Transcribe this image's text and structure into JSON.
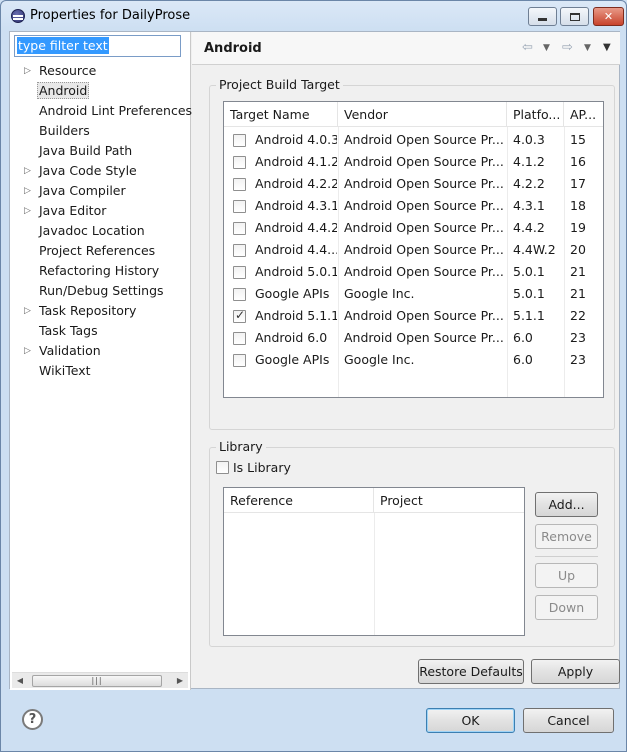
{
  "window": {
    "title": "Properties for DailyProse"
  },
  "filter": {
    "placeholder": "type filter text"
  },
  "tree": [
    {
      "label": "Resource",
      "expandable": true
    },
    {
      "label": "Android",
      "expandable": false,
      "selected": true
    },
    {
      "label": "Android Lint Preferences",
      "expandable": false
    },
    {
      "label": "Builders",
      "expandable": false
    },
    {
      "label": "Java Build Path",
      "expandable": false
    },
    {
      "label": "Java Code Style",
      "expandable": true
    },
    {
      "label": "Java Compiler",
      "expandable": true
    },
    {
      "label": "Java Editor",
      "expandable": true
    },
    {
      "label": "Javadoc Location",
      "expandable": false
    },
    {
      "label": "Project References",
      "expandable": false
    },
    {
      "label": "Refactoring History",
      "expandable": false
    },
    {
      "label": "Run/Debug Settings",
      "expandable": false
    },
    {
      "label": "Task Repository",
      "expandable": true
    },
    {
      "label": "Task Tags",
      "expandable": false
    },
    {
      "label": "Validation",
      "expandable": true
    },
    {
      "label": "WikiText",
      "expandable": false
    }
  ],
  "page": {
    "title": "Android"
  },
  "build_target": {
    "group_label": "Project Build Target",
    "columns": [
      "Target Name",
      "Vendor",
      "Platfo...",
      "AP..."
    ],
    "rows": [
      {
        "name": "Android 4.0.3",
        "vendor": "Android Open Source Pr...",
        "platform": "4.0.3",
        "api": "15",
        "checked": false
      },
      {
        "name": "Android 4.1.2",
        "vendor": "Android Open Source Pr...",
        "platform": "4.1.2",
        "api": "16",
        "checked": false
      },
      {
        "name": "Android 4.2.2",
        "vendor": "Android Open Source Pr...",
        "platform": "4.2.2",
        "api": "17",
        "checked": false
      },
      {
        "name": "Android 4.3.1",
        "vendor": "Android Open Source Pr...",
        "platform": "4.3.1",
        "api": "18",
        "checked": false
      },
      {
        "name": "Android 4.4.2",
        "vendor": "Android Open Source Pr...",
        "platform": "4.4.2",
        "api": "19",
        "checked": false
      },
      {
        "name": "Android 4.4...",
        "vendor": "Android Open Source Pr...",
        "platform": "4.4W.2",
        "api": "20",
        "checked": false
      },
      {
        "name": "Android 5.0.1",
        "vendor": "Android Open Source Pr...",
        "platform": "5.0.1",
        "api": "21",
        "checked": false
      },
      {
        "name": "Google APIs",
        "vendor": "Google Inc.",
        "platform": "5.0.1",
        "api": "21",
        "checked": false
      },
      {
        "name": "Android 5.1.1",
        "vendor": "Android Open Source Pr...",
        "platform": "5.1.1",
        "api": "22",
        "checked": true
      },
      {
        "name": "Android 6.0",
        "vendor": "Android Open Source Pr...",
        "platform": "6.0",
        "api": "23",
        "checked": false
      },
      {
        "name": "Google APIs",
        "vendor": "Google Inc.",
        "platform": "6.0",
        "api": "23",
        "checked": false
      }
    ]
  },
  "library": {
    "group_label": "Library",
    "is_library_label": "Is Library",
    "is_library_checked": false,
    "columns": [
      "Reference",
      "Project"
    ],
    "add_label": "Add...",
    "remove_label": "Remove",
    "up_label": "Up",
    "down_label": "Down"
  },
  "actions": {
    "restore_label": "Restore Defaults",
    "apply_label": "Apply"
  },
  "footer": {
    "help_glyph": "?",
    "ok_label": "OK",
    "cancel_label": "Cancel"
  },
  "icons": {
    "title": "eclipse-icon",
    "back": "back-arrow-icon",
    "forward": "forward-arrow-icon",
    "menu": "view-menu-icon"
  }
}
